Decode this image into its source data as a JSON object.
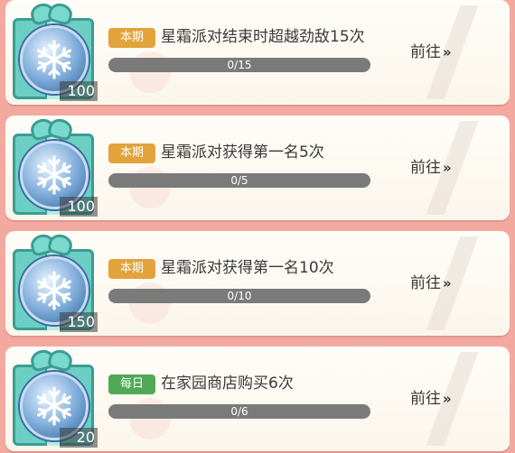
{
  "tasks": [
    {
      "tag": "本期",
      "tag_type": "period",
      "title": "星霜派对结束时超越劲敌15次",
      "progress_text": "0/15",
      "progress": 0,
      "reward": "100",
      "go_label": "前往",
      "go_arrow": "»"
    },
    {
      "tag": "本期",
      "tag_type": "period",
      "title": "星霜派对获得第一名5次",
      "progress_text": "0/5",
      "progress": 0,
      "reward": "100",
      "go_label": "前往",
      "go_arrow": "»"
    },
    {
      "tag": "本期",
      "tag_type": "period",
      "title": "星霜派对获得第一名10次",
      "progress_text": "0/10",
      "progress": 0,
      "reward": "150",
      "go_label": "前往",
      "go_arrow": "»"
    },
    {
      "tag": "每日",
      "tag_type": "daily",
      "title": "在家园商店购买6次",
      "progress_text": "0/6",
      "progress": 0,
      "reward": "20",
      "go_label": "前往",
      "go_arrow": "»"
    }
  ],
  "colors": {
    "period_tag": "#e2a33b",
    "daily_tag": "#4fa957",
    "progress_track": "#7a7a7a",
    "background": "#f3a9a0"
  },
  "icons": {
    "reward": "snowflake-coin-gift-icon",
    "go": "double-chevron-right-icon"
  }
}
